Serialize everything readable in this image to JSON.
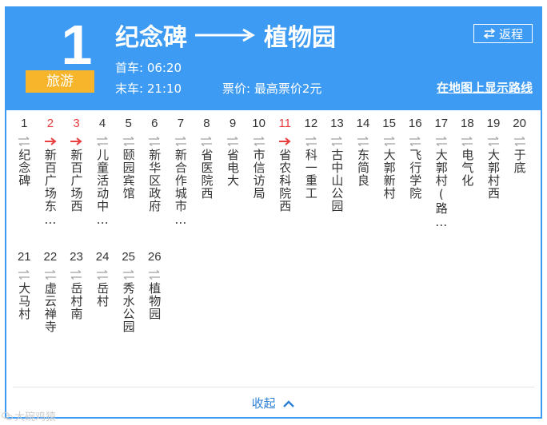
{
  "route": {
    "number": "1",
    "tag": "旅游"
  },
  "direction": {
    "from": "纪念碑",
    "to": "植物园"
  },
  "schedule": {
    "first": "首车: 06:20",
    "last": "末车: 21:10"
  },
  "fare": "票价: 最高票价2元",
  "return_label": "返程",
  "map_link": "在地图上显示路线",
  "collapse_label": "收起",
  "watermark": "大碗鸡猿",
  "colors": {
    "header": "#3d9bf3",
    "tag": "#f7b52c",
    "highlight": "#e83e3e",
    "link": "#2d7fd8"
  },
  "stops": [
    {
      "index": "1",
      "name": "纪念碑",
      "highlight": false
    },
    {
      "index": "2",
      "name": "新百广场东…",
      "highlight": true
    },
    {
      "index": "3",
      "name": "新百广场西",
      "highlight": true
    },
    {
      "index": "4",
      "name": "儿童活动中…",
      "highlight": false
    },
    {
      "index": "5",
      "name": "颐园宾馆",
      "highlight": false
    },
    {
      "index": "6",
      "name": "新华区政府",
      "highlight": false
    },
    {
      "index": "7",
      "name": "新合作城市…",
      "highlight": false
    },
    {
      "index": "8",
      "name": "省医院西",
      "highlight": false
    },
    {
      "index": "9",
      "name": "省电大",
      "highlight": false
    },
    {
      "index": "10",
      "name": "市信访局",
      "highlight": false
    },
    {
      "index": "11",
      "name": "省农科院西",
      "highlight": true
    },
    {
      "index": "12",
      "name": "科一重工",
      "highlight": false
    },
    {
      "index": "13",
      "name": "古中山公园",
      "highlight": false
    },
    {
      "index": "14",
      "name": "东简良",
      "highlight": false
    },
    {
      "index": "15",
      "name": "大郭新村",
      "highlight": false
    },
    {
      "index": "16",
      "name": "飞行学院",
      "highlight": false
    },
    {
      "index": "17",
      "name": "大郭村(路…",
      "highlight": false
    },
    {
      "index": "18",
      "name": "电气化",
      "highlight": false
    },
    {
      "index": "19",
      "name": "大郭村西",
      "highlight": false
    },
    {
      "index": "20",
      "name": "于底",
      "highlight": false
    },
    {
      "index": "21",
      "name": "大马村",
      "highlight": false
    },
    {
      "index": "22",
      "name": "虚云禅寺",
      "highlight": false
    },
    {
      "index": "23",
      "name": "岳村南",
      "highlight": false
    },
    {
      "index": "24",
      "name": "岳村",
      "highlight": false
    },
    {
      "index": "25",
      "name": "秀水公园",
      "highlight": false
    },
    {
      "index": "26",
      "name": "植物园",
      "highlight": false
    }
  ]
}
